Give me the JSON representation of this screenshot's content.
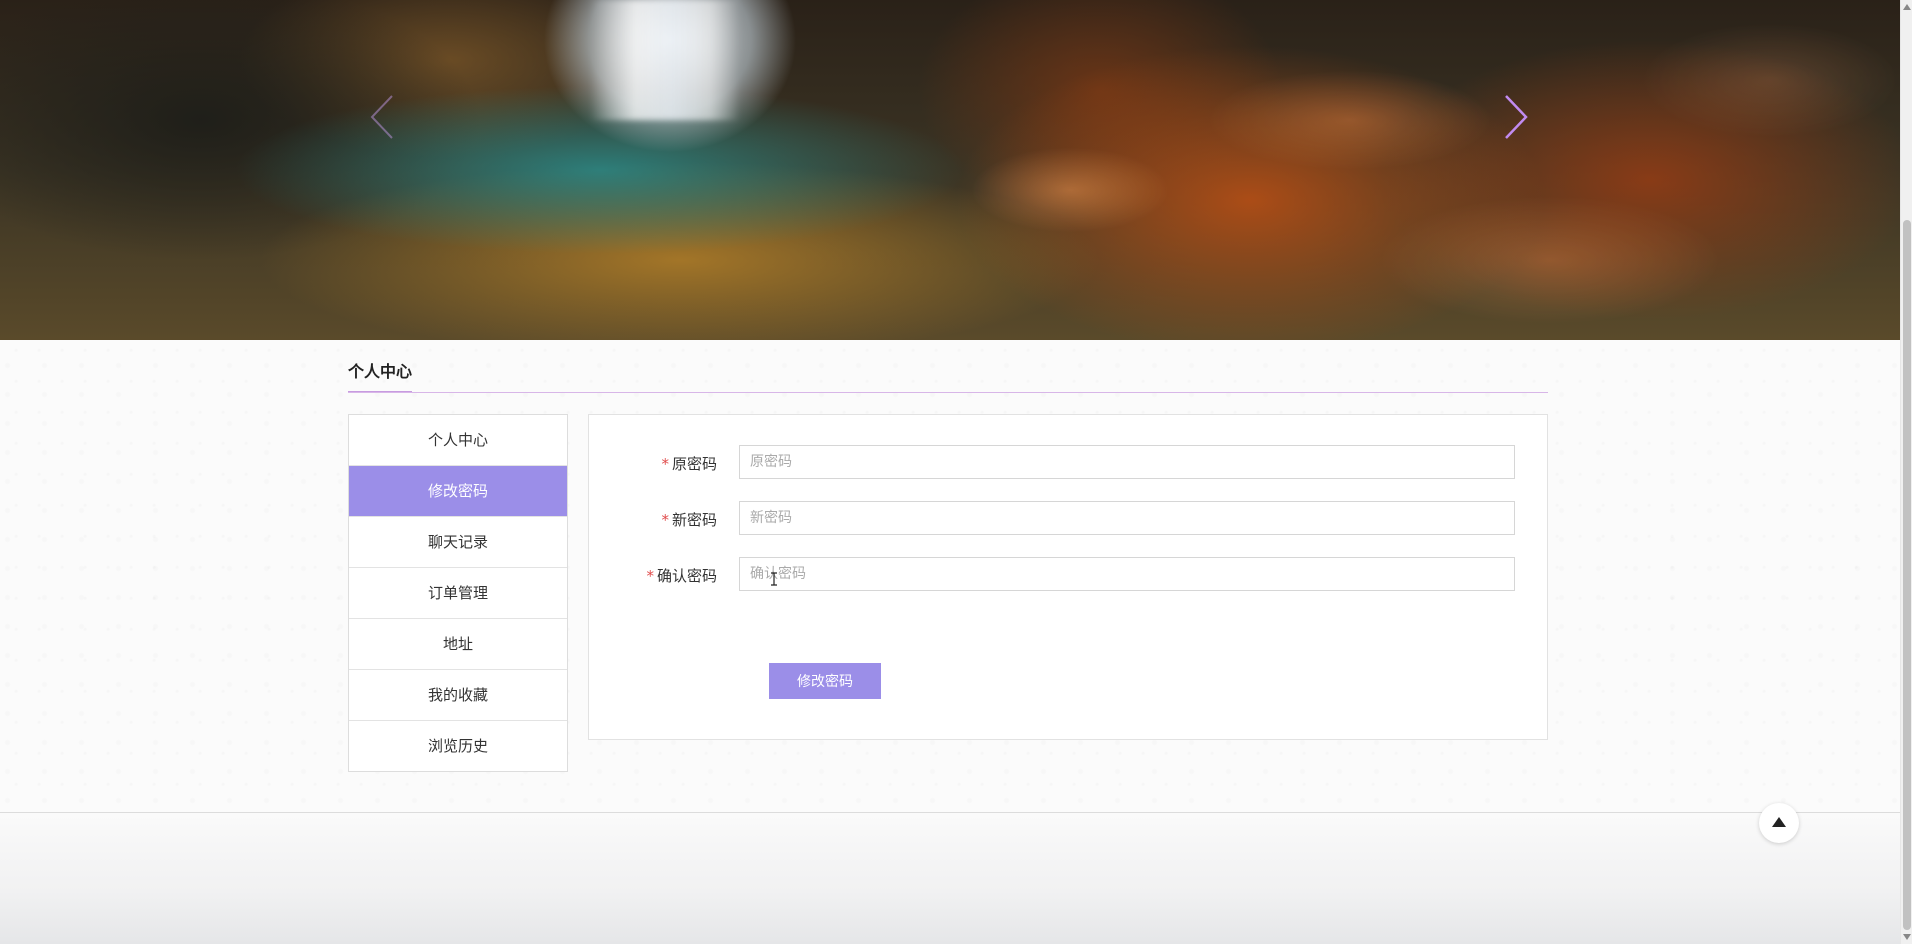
{
  "banner": {
    "prev_icon": "chevron-left",
    "next_icon": "chevron-right",
    "arrow_color": "#c18bf0"
  },
  "section": {
    "title": "个人中心"
  },
  "sidebar": {
    "active_color": "#9b8ee8",
    "items": [
      {
        "label": "个人中心",
        "active": false
      },
      {
        "label": "修改密码",
        "active": true
      },
      {
        "label": "聊天记录",
        "active": false
      },
      {
        "label": "订单管理",
        "active": false
      },
      {
        "label": "地址",
        "active": false
      },
      {
        "label": "我的收藏",
        "active": false
      },
      {
        "label": "浏览历史",
        "active": false
      }
    ]
  },
  "form": {
    "required_mark": "*",
    "fields": [
      {
        "label": "原密码",
        "placeholder": "原密码",
        "value": ""
      },
      {
        "label": "新密码",
        "placeholder": "新密码",
        "value": ""
      },
      {
        "label": "确认密码",
        "placeholder": "确认密码",
        "value": ""
      }
    ],
    "submit_label": "修改密码"
  },
  "footer": {
    "back_to_top_icon": "caret-up"
  }
}
